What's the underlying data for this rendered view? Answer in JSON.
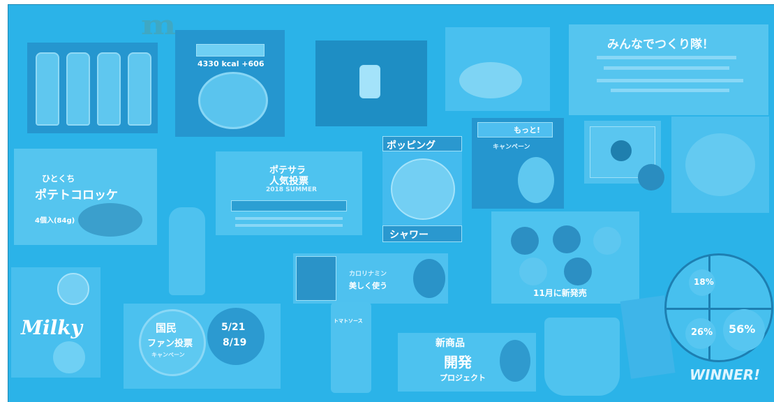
{
  "collage": {
    "promo_counter": "4330 kcal +606",
    "together_title": "みんなでつくり隊！",
    "croquette_title": "ひとくち",
    "croquette_name": "ポテトコロッケ",
    "croquette_count": "4個入(84g)",
    "summer_title_1": "ポテサラ",
    "summer_title_2": "2018 SUMMER",
    "summer_banner": "人気投票",
    "popping_top": "ポッピング",
    "popping_bottom": "シャワー",
    "chance_badge": "もっと!",
    "chance_title": "キャンペーン",
    "donut_label": "11月に新発売",
    "mini_title": "美しく使う",
    "mini_subtitle": "カロリナミン",
    "vote_title_1": "国民",
    "vote_title_2": "ファン投票",
    "vote_campaign": "キャンペーン",
    "vote_dates_1": "5/21",
    "vote_dates_2": "8/19",
    "milky": "Milky",
    "sauce_label": "トマトソース",
    "new_product_1": "新商品",
    "new_product_2": "開発",
    "new_product_3": "プロジェクト",
    "pie_18": "18%",
    "pie_26": "26%",
    "pie_56": "56%",
    "winner_text": "WINNER!"
  },
  "colors": {
    "overlay": "#2bb3e8",
    "tile_tint": "#3ab9ec",
    "text_light": "#ffffff"
  }
}
